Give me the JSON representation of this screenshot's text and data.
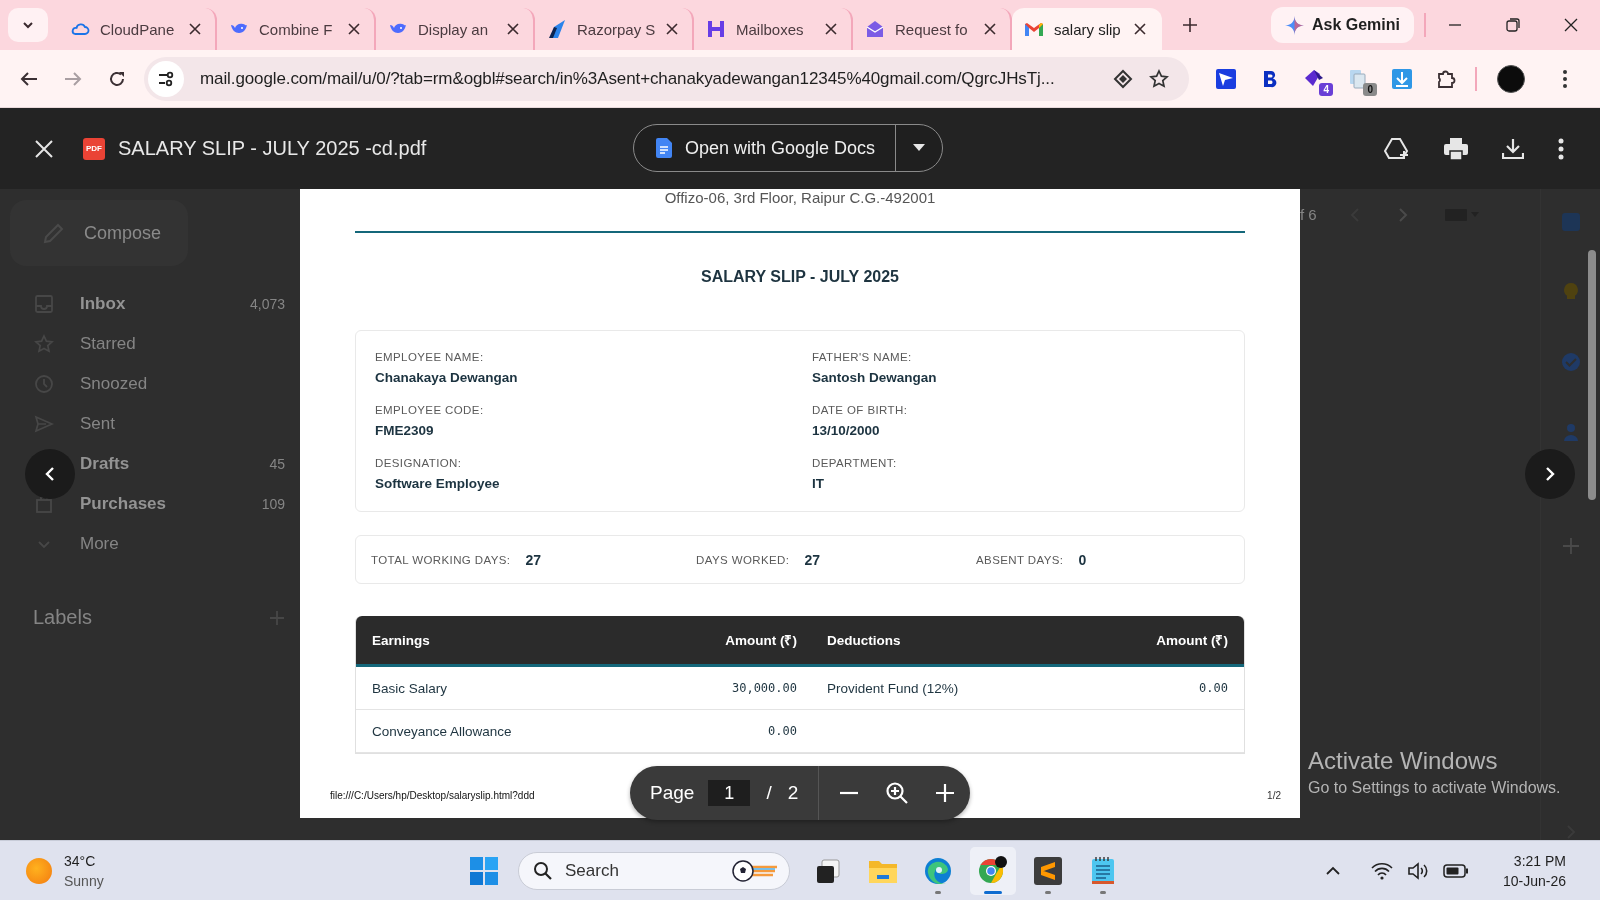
{
  "browser": {
    "tabs": [
      {
        "title": "CloudPane",
        "kind": "cloud",
        "selected": false
      },
      {
        "title": "Combine F",
        "kind": "whale",
        "selected": false
      },
      {
        "title": "Display an",
        "kind": "whale",
        "selected": false
      },
      {
        "title": "Razorpay S",
        "kind": "slash",
        "selected": false
      },
      {
        "title": "Mailboxes",
        "kind": "h",
        "selected": false
      },
      {
        "title": "Request fo",
        "kind": "envelope",
        "selected": false
      },
      {
        "title": "salary slip",
        "kind": "gmail",
        "selected": true
      }
    ],
    "gemini_button": "Ask Gemini",
    "url": "mail.google.com/mail/u/0/?tab=rm&ogbl#search/in%3Asent+chanakyadewangan12345%40gmail.com/QgrcJHsTj...",
    "extensions": [
      {
        "kind": "plane"
      },
      {
        "kind": "b"
      },
      {
        "kind": "diamond",
        "badge": "4"
      },
      {
        "kind": "copy",
        "badge": "0"
      },
      {
        "kind": "download"
      },
      {
        "kind": "puzzle"
      }
    ]
  },
  "gmail": {
    "compose": "Compose",
    "nav": [
      {
        "label": "Inbox",
        "count": "4,073",
        "unread": true,
        "kind": "inbox"
      },
      {
        "label": "Starred",
        "unread": false,
        "kind": "star"
      },
      {
        "label": "Snoozed",
        "unread": false,
        "kind": "clock"
      },
      {
        "label": "Sent",
        "unread": false,
        "kind": "send"
      },
      {
        "label": "Drafts",
        "count": "45",
        "unread": true,
        "kind": "hidden"
      },
      {
        "label": "Purchases",
        "count": "109",
        "unread": true,
        "kind": "bag"
      },
      {
        "label": "More",
        "unread": false,
        "kind": "chevron"
      }
    ],
    "labels_heading": "Labels",
    "pager": "f 6"
  },
  "viewer": {
    "file_icon_label": "PDF",
    "file_name": "SALARY SLIP - JULY 2025 -cd.pdf",
    "open_with": "Open with Google Docs",
    "page_label": "Page",
    "page_current": "1",
    "page_separator": "/",
    "page_total": "2"
  },
  "document": {
    "address": "Offizo-06, 3rd Floor, Raipur C.G.-492001",
    "title": "SALARY SLIP - JULY 2025",
    "employee": [
      {
        "label": "EMPLOYEE NAME:",
        "value": "Chanakaya Dewangan"
      },
      {
        "label": "FATHER'S NAME:",
        "value": "Santosh Dewangan"
      },
      {
        "label": "EMPLOYEE CODE:",
        "value": "FME2309"
      },
      {
        "label": "DATE OF BIRTH:",
        "value": "13/10/2000"
      },
      {
        "label": "DESIGNATION:",
        "value": "Software Employee"
      },
      {
        "label": "DEPARTMENT:",
        "value": "IT"
      }
    ],
    "attendance": [
      {
        "label": "TOTAL WORKING DAYS:",
        "value": "27"
      },
      {
        "label": "DAYS WORKED:",
        "value": "27"
      },
      {
        "label": "ABSENT DAYS:",
        "value": "0"
      }
    ],
    "table": {
      "columns": [
        "Earnings",
        "Amount (₹)",
        "Deductions",
        "Amount (₹)"
      ],
      "rows": [
        {
          "earning": "Basic Salary",
          "earning_amount": "30,000.00",
          "deduction": "Provident Fund (12%)",
          "deduction_amount": "0.00"
        },
        {
          "earning": "Conveyance Allowance",
          "earning_amount": "0.00"
        }
      ]
    },
    "footer_url": "file:///C:/Users/hp/Desktop/salaryslip.html?ddd",
    "page_number": "1/2"
  },
  "watermark": {
    "title": "Activate Windows",
    "subtitle": "Go to Settings to activate Windows."
  },
  "taskbar": {
    "temperature": "34°C",
    "condition": "Sunny",
    "search_placeholder": "Search",
    "apps": [
      {
        "kind": "task-view",
        "running": false,
        "selected": false
      },
      {
        "kind": "explorer",
        "running": false,
        "selected": false
      },
      {
        "kind": "edge",
        "running": true,
        "selected": false
      },
      {
        "kind": "chrome",
        "running": true,
        "selected": true
      },
      {
        "kind": "sublime",
        "running": true,
        "selected": false
      },
      {
        "kind": "notepad",
        "running": true,
        "selected": false
      }
    ],
    "time": "3:21 PM",
    "date": "10-Jun-26"
  }
}
